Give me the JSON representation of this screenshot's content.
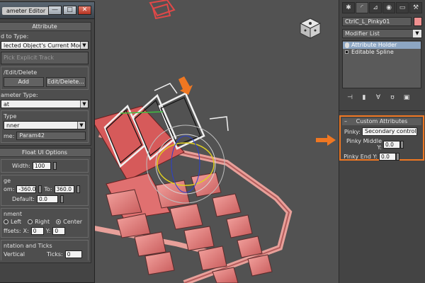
{
  "parameter_editor": {
    "title": "ameter Editor",
    "window_buttons": {
      "minimize": "—",
      "maximize": "□",
      "close": "✕"
    },
    "attribute": {
      "header": "Attribute",
      "add_to_type_label": "d to Type:",
      "add_to_type_value": "lected Object's Current Modifier",
      "pick_track_label": "Pick Explicit Track",
      "add_edit_delete_label": "/Edit/Delete",
      "add_button": "Add",
      "edit_delete_button": "Edit/Delete...",
      "parameter_type_label": "ameter Type:",
      "parameter_type_value": "at",
      "ui_type_label": "Type",
      "ui_type_value": "nner",
      "name_label": "me:",
      "name_value": "Param42"
    },
    "float_ui": {
      "header": "Float UI Options",
      "width_label": "Width:",
      "width_value": "100",
      "range_label": "ge",
      "from_label": "om:",
      "from_value": "-360.0",
      "to_label": "To:",
      "to_value": "360.0",
      "default_label": "Default:",
      "default_value": "0.0",
      "alignment_label": "nment",
      "align_left": "Left",
      "align_right": "Right",
      "align_center": "Center",
      "offsets_label": "ffsets:",
      "x_label": "X:",
      "x_value": "0",
      "y_label": "Y:",
      "y_value": "0",
      "orient_label": "ntation and Ticks",
      "vertical_label": "Vertical",
      "ticks_label": "Ticks:",
      "ticks_value": "0"
    }
  },
  "command_panel": {
    "tabs": [
      "create-tab",
      "modify-tab",
      "hierarchy-tab",
      "motion-tab",
      "display-tab",
      "utilities-tab"
    ],
    "object_name": "CtrlC_L_Pinky01",
    "object_color": "#f09090",
    "modifier_list": "Modifier List",
    "stack": [
      {
        "label": "Attribute Holder",
        "selected": true
      },
      {
        "label": "Editable Spline",
        "selected": false
      }
    ],
    "custom_attributes": {
      "header": "Custom Attributes",
      "pinky_label": "Pinky:",
      "pinky_value": "Secondary control",
      "pinky_middle_label": "Pinky Middle Y:",
      "pinky_middle_value": "0.0",
      "pinky_end_label": "Pinky End Y:",
      "pinky_end_value": "0.0"
    }
  },
  "colors": {
    "highlight": "#ef7722",
    "model": "#f09090"
  }
}
